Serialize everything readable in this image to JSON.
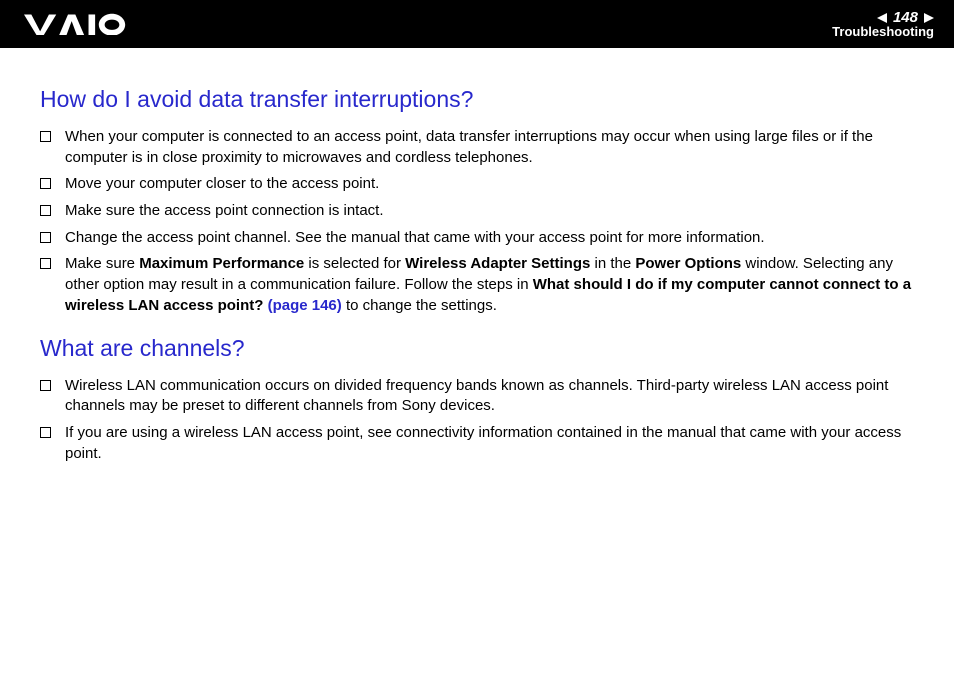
{
  "header": {
    "page_number": "148",
    "section": "Troubleshooting"
  },
  "sections": [
    {
      "heading": "How do I avoid data transfer interruptions?",
      "items": [
        {
          "parts": [
            {
              "text": "When your computer is connected to an access point, data transfer interruptions may occur when using large files or if the computer is in close proximity to microwaves and cordless telephones."
            }
          ]
        },
        {
          "parts": [
            {
              "text": "Move your computer closer to the access point."
            }
          ]
        },
        {
          "parts": [
            {
              "text": "Make sure the access point connection is intact."
            }
          ]
        },
        {
          "parts": [
            {
              "text": "Change the access point channel. See the manual that came with your access point for more information."
            }
          ]
        },
        {
          "parts": [
            {
              "text": "Make sure "
            },
            {
              "text": "Maximum Performance",
              "bold": true
            },
            {
              "text": " is selected for "
            },
            {
              "text": "Wireless Adapter Settings",
              "bold": true
            },
            {
              "text": " in the "
            },
            {
              "text": "Power Options",
              "bold": true
            },
            {
              "text": " window. Selecting any other option may result in a communication failure. Follow the steps in "
            },
            {
              "text": "What should I do if my computer cannot connect to a wireless LAN access point? ",
              "bold": true
            },
            {
              "text": "(page 146)",
              "link": true,
              "bold": true
            },
            {
              "text": " to change the settings."
            }
          ]
        }
      ]
    },
    {
      "heading": "What are channels?",
      "items": [
        {
          "parts": [
            {
              "text": "Wireless LAN communication occurs on divided frequency bands known as channels. Third-party wireless LAN access point channels may be preset to different channels from Sony devices."
            }
          ]
        },
        {
          "parts": [
            {
              "text": "If you are using a wireless LAN access point, see connectivity information contained in the manual that came with your access point."
            }
          ]
        }
      ]
    }
  ]
}
